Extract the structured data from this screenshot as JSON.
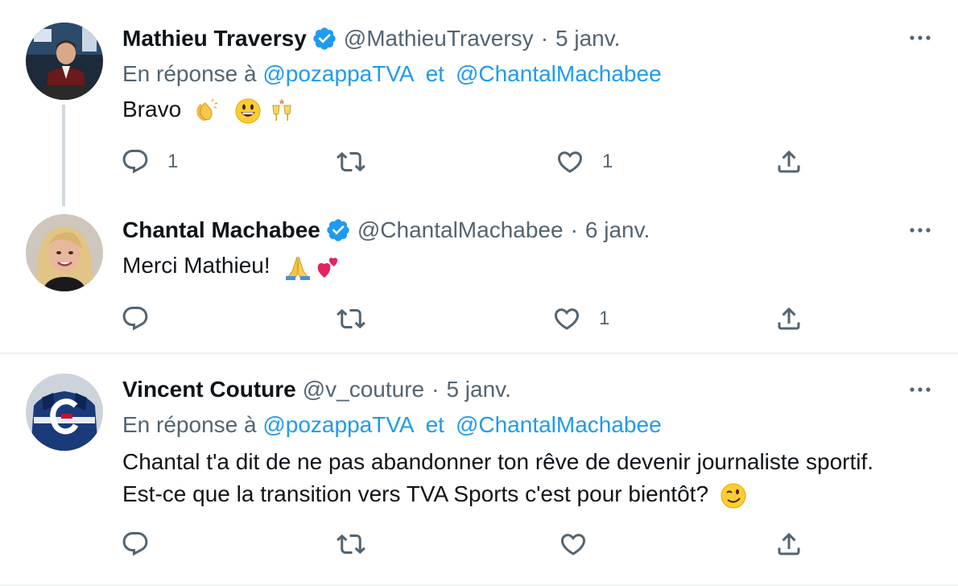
{
  "tweets": [
    {
      "name": "Mathieu Traversy",
      "handle": "@MathieuTraversy",
      "dot": "·",
      "time": "5 janv.",
      "verified": true,
      "reply_prefix": "En réponse à",
      "reply_mention_1": "@pozappaTVA",
      "reply_sep": "et",
      "reply_mention_2": "@ChantalMachabee",
      "text": "Bravo",
      "emojis": [
        "clapping-hands",
        "grinning-face",
        "clinking-glasses"
      ],
      "reply_count": "1",
      "like_count": "1"
    },
    {
      "name": "Chantal Machabee",
      "handle": "@ChantalMachabee",
      "dot": "·",
      "time": "6 janv.",
      "verified": true,
      "text": "Merci Mathieu!",
      "emojis": [
        "folded-hands",
        "two-hearts"
      ],
      "reply_count": "",
      "like_count": "1"
    },
    {
      "name": "Vincent Couture",
      "handle": "@v_couture",
      "dot": "·",
      "time": "5 janv.",
      "verified": false,
      "reply_prefix": "En réponse à",
      "reply_mention_1": "@pozappaTVA",
      "reply_sep": "et",
      "reply_mention_2": "@ChantalMachabee",
      "text_line_1": "Chantal t'a dit de ne pas abandonner ton rêve de devenir journaliste sportif.",
      "text_line_2": "Est-ce que la transition vers TVA Sports c'est pour bientôt?",
      "emojis": [
        "winking-face"
      ],
      "reply_count": "",
      "like_count": ""
    }
  ],
  "colors": {
    "text": "#0f1419",
    "secondary": "#536471",
    "accent": "#1d9bf0",
    "divider": "#eff3f4",
    "thread_line": "#cfd9de"
  }
}
